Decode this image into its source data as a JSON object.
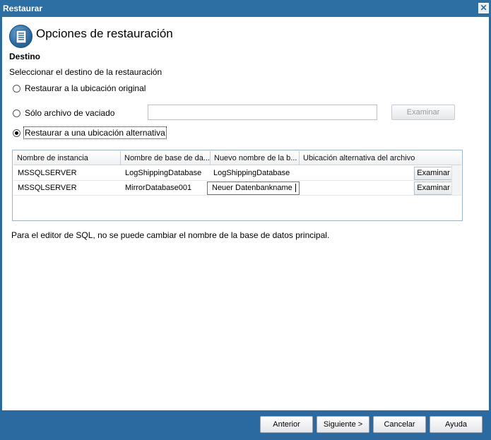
{
  "window": {
    "title": "Restaurar",
    "close_glyph": "✕"
  },
  "header": {
    "title": "Opciones de restauración",
    "icon": "document-list-icon"
  },
  "destination": {
    "section_title": "Destino",
    "description": "Seleccionar el destino de la restauración",
    "options": [
      {
        "label": "Restaurar a la ubicación original",
        "selected": false
      },
      {
        "label": "Sólo archivo de vaciado",
        "selected": false
      },
      {
        "label": "Restaurar a una ubicación alternativa",
        "selected": true
      }
    ],
    "dump_file_value": "",
    "browse_label": "Examinar"
  },
  "grid": {
    "columns": [
      "Nombre de instancia",
      "Nombre de base de da...",
      "Nuevo nombre de la b...",
      "Ubicación alternativa del archivo"
    ],
    "rows": [
      {
        "instance": "MSSQLSERVER",
        "database": "LogShippingDatabase",
        "new_name": "LogShippingDatabase",
        "alt_location": "",
        "browse": "Examinar"
      },
      {
        "instance": "MSSQLSERVER",
        "database": "MirrorDatabase001",
        "new_name": "Neuer Datenbankname",
        "alt_location": "",
        "browse": "Examinar"
      }
    ]
  },
  "note": "Para el editor de SQL, no se puede cambiar el nombre de la base de datos principal.",
  "footer": {
    "back": "Anterior",
    "next": "Siguiente >",
    "cancel": "Cancelar",
    "help": "Ayuda"
  }
}
